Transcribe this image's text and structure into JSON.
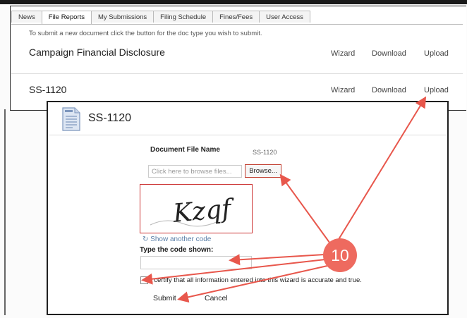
{
  "tabs": [
    "News",
    "File Reports",
    "My Submissions",
    "Filing Schedule",
    "Fines/Fees",
    "User Access"
  ],
  "active_tab": "File Reports",
  "intro_text": "To submit a new document click the button for the doc type you wish to submit.",
  "documents": [
    {
      "title": "Campaign Financial Disclosure",
      "wizard": "Wizard",
      "download": "Download",
      "upload": "Upload"
    },
    {
      "title": "SS-1120",
      "wizard": "Wizard",
      "download": "Download",
      "upload": "Upload"
    }
  ],
  "modal": {
    "title": "SS-1120",
    "file_label": "Document File Name",
    "file_name": "SS-1120",
    "file_placeholder": "Click here to browse files...",
    "browse_label": "Browse...",
    "captcha_text": "Kzqf",
    "show_another_code": "Show another code",
    "code_label": "Type the code shown:",
    "certify_text": "I certify that all information entered into this wizard is accurate and true.",
    "submit_label": "Submit",
    "cancel_label": "Cancel"
  },
  "annotation": {
    "number": "10",
    "color": "#e8574c"
  }
}
